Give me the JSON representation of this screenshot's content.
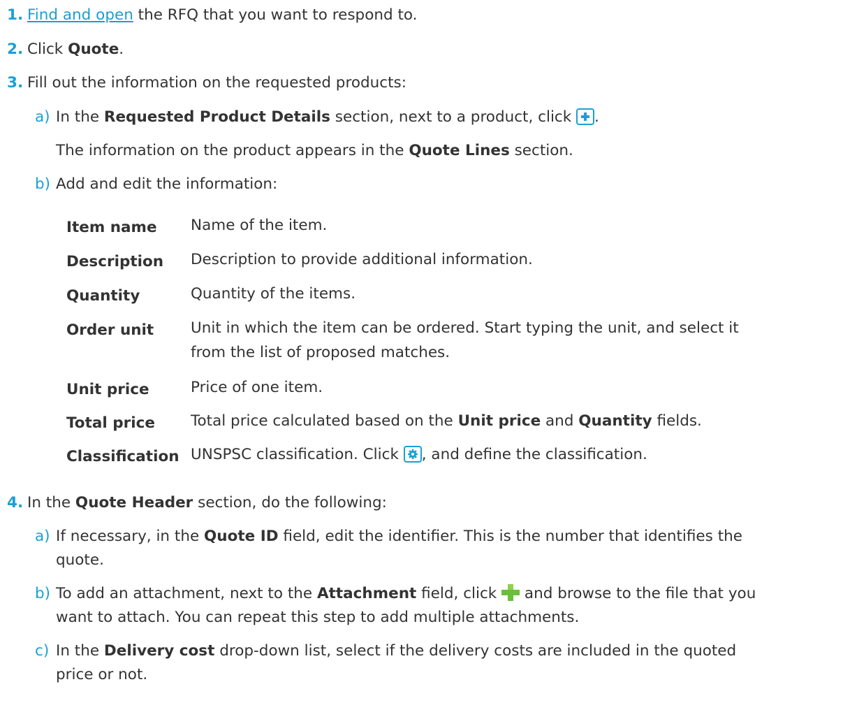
{
  "steps": [
    {
      "num": "1.",
      "link": "Find and open",
      "rest": " the RFQ that you want to respond to."
    },
    {
      "num": "2.",
      "pre": "Click ",
      "bold": "Quote",
      "post": "."
    },
    {
      "num": "3.",
      "text": "Fill out the information on the requested products:"
    },
    {
      "num": "4.",
      "pre": "In the ",
      "bold": "Quote Header",
      "post": " section, do the following:"
    }
  ],
  "step3": {
    "a": {
      "letter": "a)",
      "pre": "In the ",
      "bold": "Requested Product Details",
      "post": " section, next to a product, click ",
      "end": "."
    },
    "a_result": {
      "pre": "The information on the product appears in the ",
      "bold": "Quote Lines",
      "post": " section."
    },
    "b": {
      "letter": "b)",
      "text": "Add and edit the information:"
    }
  },
  "definitions": [
    {
      "term": "Item name",
      "desc": "Name of the item."
    },
    {
      "term": "Description",
      "desc": "Description to provide additional information."
    },
    {
      "term": "Quantity",
      "desc": "Quantity of the items."
    },
    {
      "term": "Order unit",
      "desc1": "Unit in which the item can be ordered. Start typing the unit, and select it",
      "desc2": "from the list of proposed matches."
    },
    {
      "term": "Unit price",
      "desc": "Price of one item."
    },
    {
      "term": "Total price",
      "pre": "Total price calculated based on the ",
      "bold1": "Unit price",
      "mid": " and ",
      "bold2": "Quantity",
      "post": " fields."
    },
    {
      "term": "Classification",
      "pre": "UNSPSC classification. Click ",
      "post": ", and define the classification."
    }
  ],
  "step4": {
    "a": {
      "letter": "a)",
      "pre": "If necessary, in the ",
      "bold": "Quote ID",
      "post": " field, edit the identifier. This is the number that identifies the",
      "line2": "quote."
    },
    "b": {
      "letter": "b)",
      "pre": "To add an attachment, next to the ",
      "bold": "Attachment",
      "mid": " field, click ",
      "post": " and browse to the file that you",
      "line2": "want to attach. You can repeat this step to add multiple attachments."
    },
    "c": {
      "letter": "c)",
      "pre": "In the ",
      "bold": "Delivery cost",
      "post": " drop-down list, select if the delivery costs are included in the quoted",
      "line2": "price or not."
    }
  },
  "colors": {
    "accent": "#1aa0d6",
    "text": "#333333",
    "green": "#6abf3b"
  }
}
